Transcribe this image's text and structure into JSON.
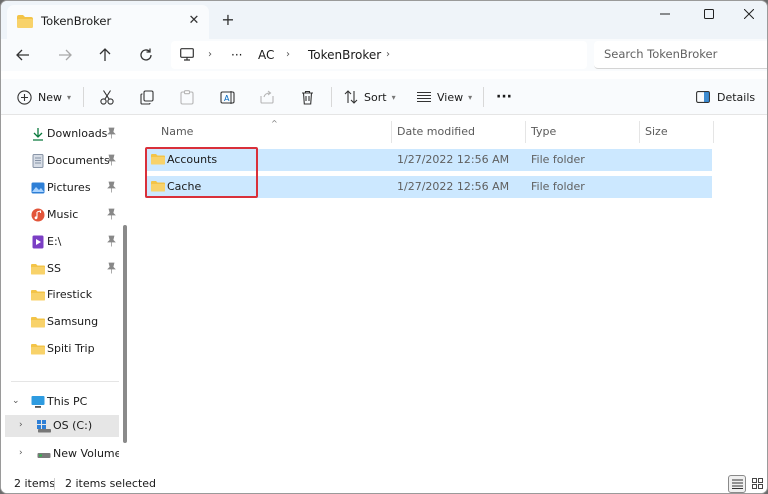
{
  "tab": {
    "title": "TokenBroker"
  },
  "address": {
    "parts": [
      "···",
      "AC",
      "TokenBroker"
    ]
  },
  "search": {
    "placeholder": "Search TokenBroker"
  },
  "toolbar": {
    "new_label": "New",
    "sort_label": "Sort",
    "view_label": "View",
    "more_label": "···",
    "details_label": "Details"
  },
  "sidebar": {
    "quick_access": [
      {
        "label": "Downloads",
        "icon": "download-icon",
        "pinned": true
      },
      {
        "label": "Documents",
        "icon": "documents-icon",
        "pinned": true
      },
      {
        "label": "Pictures",
        "icon": "pictures-icon",
        "pinned": true
      },
      {
        "label": "Music",
        "icon": "music-icon",
        "pinned": true
      },
      {
        "label": "E:\\",
        "icon": "drive-e-icon",
        "pinned": true
      },
      {
        "label": "SS",
        "icon": "folder-icon",
        "pinned": true
      },
      {
        "label": "Firestick",
        "icon": "folder-icon",
        "pinned": false
      },
      {
        "label": "Samsung",
        "icon": "folder-icon",
        "pinned": false
      },
      {
        "label": "Spiti Trip",
        "icon": "folder-icon",
        "pinned": false
      }
    ],
    "this_pc": {
      "label": "This PC",
      "children": [
        {
          "label": "OS (C:)"
        },
        {
          "label": "New Volume (E"
        }
      ]
    }
  },
  "columns": {
    "name": "Name",
    "date": "Date modified",
    "type": "Type",
    "size": "Size"
  },
  "files": [
    {
      "name": "Accounts",
      "date": "1/27/2022 12:56 AM",
      "type": "File folder",
      "size": ""
    },
    {
      "name": "Cache",
      "date": "1/27/2022 12:56 AM",
      "type": "File folder",
      "size": ""
    }
  ],
  "status": {
    "count": "2 items",
    "selected": "2 items selected"
  },
  "colors": {
    "folder": "#f3c448",
    "selection": "#cce8ff",
    "highlight": "#d9303a",
    "accent": "#0067c0"
  }
}
